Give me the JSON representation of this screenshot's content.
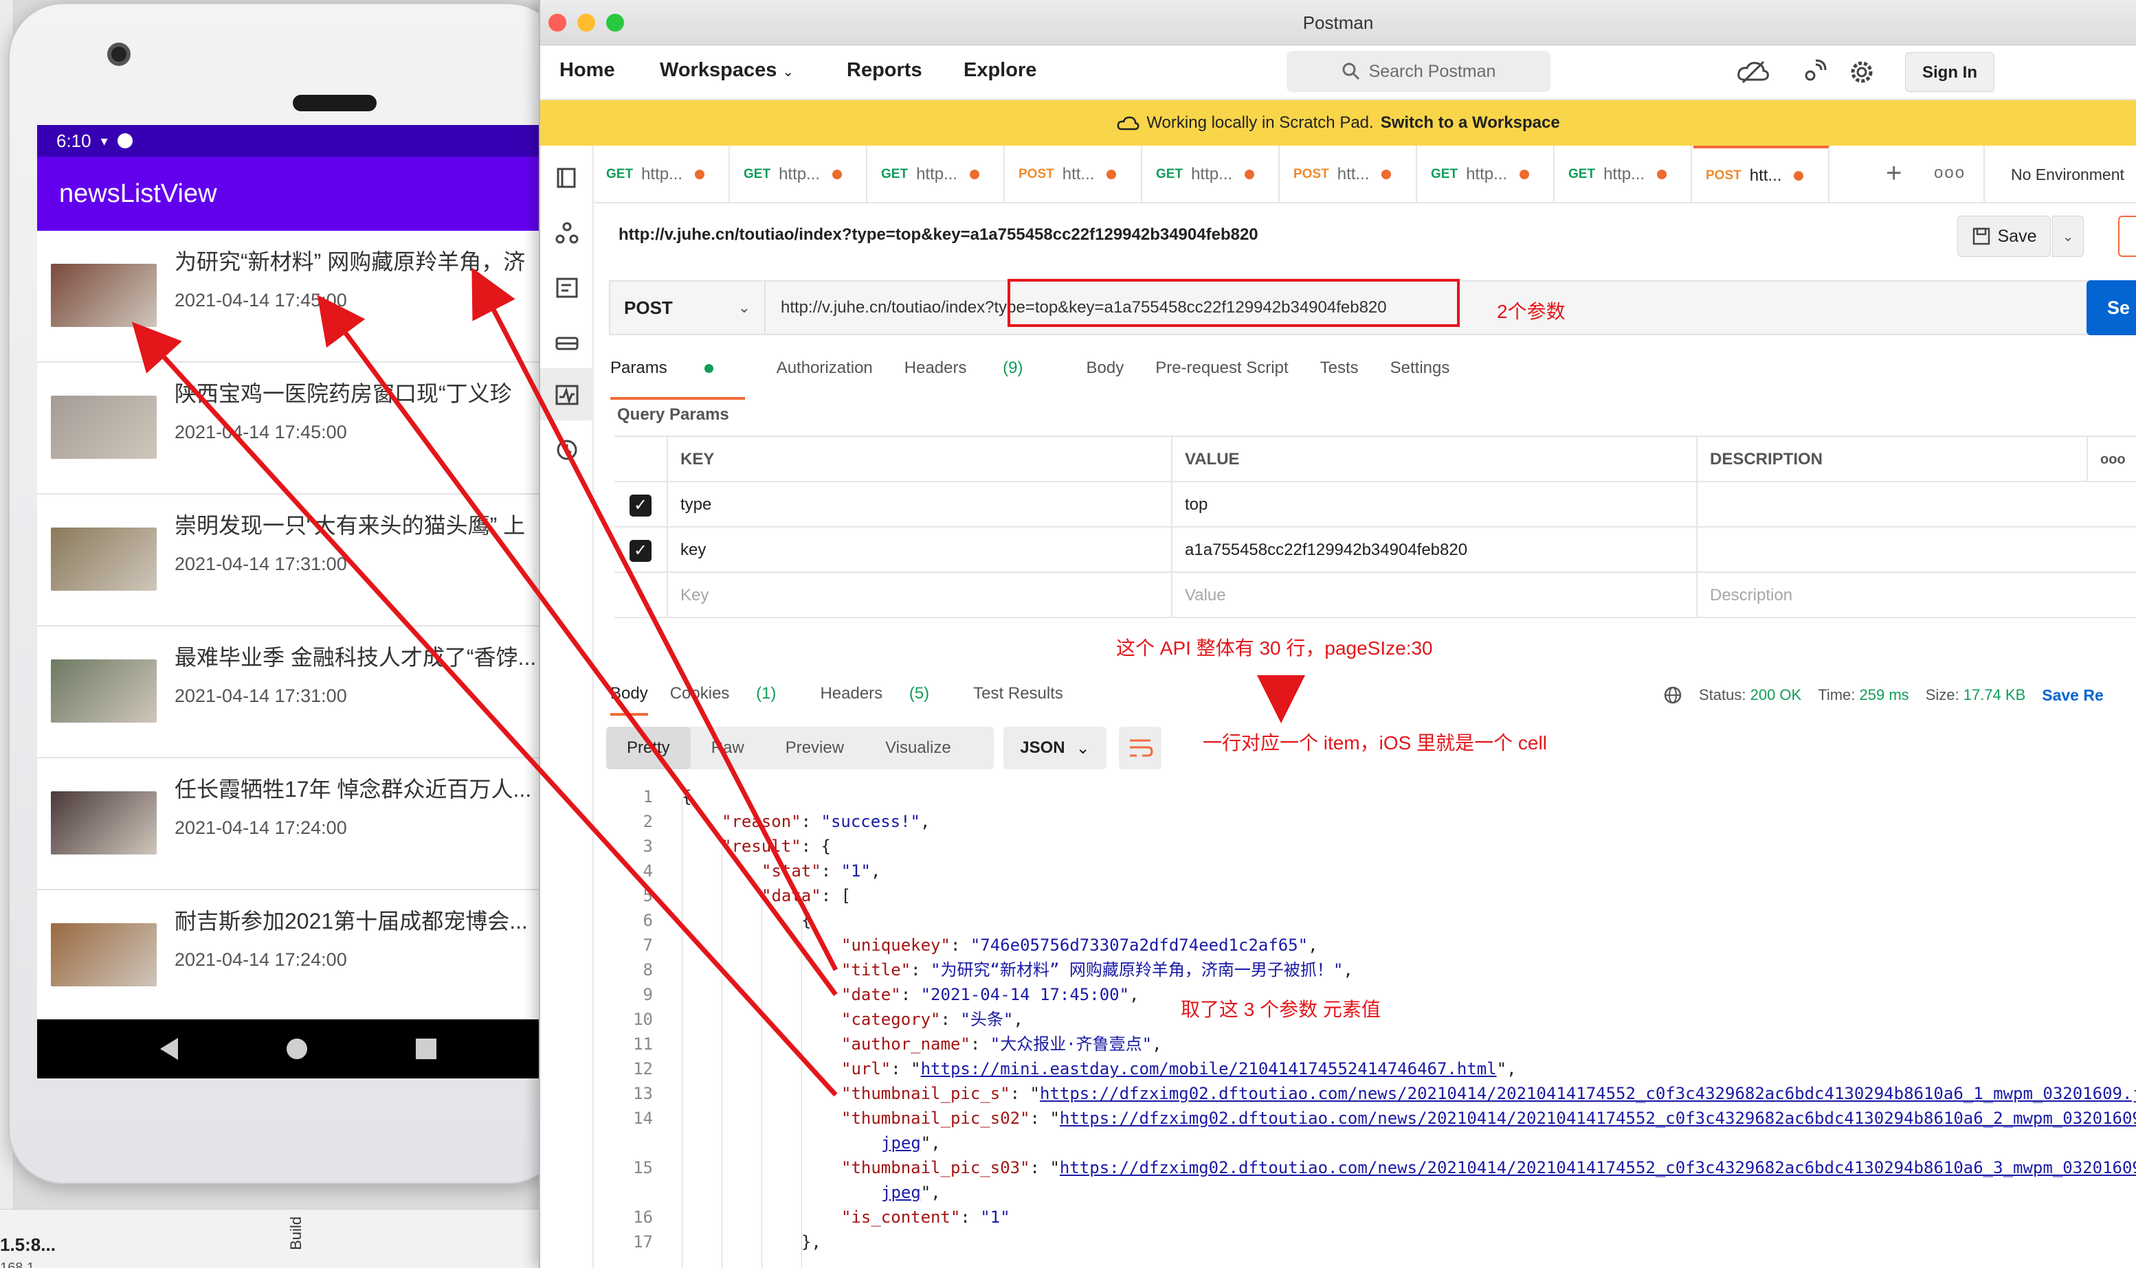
{
  "ide": {
    "version_fragment": "1.5:8...",
    "sub_fragment": "168.1",
    "build_label": "Build"
  },
  "android": {
    "status_time": "6:10",
    "app_title": "newsListView",
    "items": [
      {
        "title": "为研究“新材料” 网购藏原羚羊角，济",
        "date": "2021-04-14 17:45:00",
        "thumb_color": "#7a4a3c"
      },
      {
        "title": "陕西宝鸡一医院药房窗口现“丁义珍",
        "date": "2021-04-14 17:45:00",
        "thumb_color": "#a39c95"
      },
      {
        "title": "崇明发现一只“大有来头的猫头鹰” 上",
        "date": "2021-04-14 17:31:00",
        "thumb_color": "#8a7a5a"
      },
      {
        "title": "最难毕业季 金融科技人才成了“香饽...",
        "date": "2021-04-14 17:31:00",
        "thumb_color": "#6e7a62"
      },
      {
        "title": "任长霞牺牲17年 悼念群众近百万人...",
        "date": "2021-04-14 17:24:00",
        "thumb_color": "#4a3a3a"
      },
      {
        "title": "耐吉斯参加2021第十届成都宠博会...",
        "date": "2021-04-14 17:24:00",
        "thumb_color": "#9a6a40"
      }
    ]
  },
  "postman": {
    "window_title": "Postman",
    "nav": {
      "home": "Home",
      "workspaces": "Workspaces",
      "reports": "Reports",
      "explore": "Explore"
    },
    "search_placeholder": "Search Postman",
    "sign_in": "Sign In",
    "banner_text": "Working locally in Scratch Pad.",
    "banner_link": "Switch to a Workspace",
    "tabs": [
      {
        "method": "GET",
        "label": "http..."
      },
      {
        "method": "GET",
        "label": "http..."
      },
      {
        "method": "GET",
        "label": "http..."
      },
      {
        "method": "POST",
        "label": "htt..."
      },
      {
        "method": "GET",
        "label": "http..."
      },
      {
        "method": "POST",
        "label": "htt..."
      },
      {
        "method": "GET",
        "label": "http..."
      },
      {
        "method": "GET",
        "label": "http..."
      },
      {
        "method": "POST",
        "label": "htt..."
      }
    ],
    "environment": "No Environment",
    "request_name": "http://v.juhe.cn/toutiao/index?type=top&key=a1a755458cc22f129942b34904feb820",
    "save": "Save",
    "method": "POST",
    "url_base": "http://v.juhe.cn/toutiao/index?",
    "url_query": "type=top&key=a1a755458cc22f129942b34904feb820",
    "send": "Se",
    "req_tabs": {
      "params": "Params",
      "authorization": "Authorization",
      "headers": "Headers",
      "headers_count": "(9)",
      "body": "Body",
      "prerequest": "Pre-request Script",
      "tests": "Tests",
      "settings": "Settings"
    },
    "query_params_label": "Query Params",
    "table_headers": {
      "key": "KEY",
      "value": "VALUE",
      "description": "DESCRIPTION",
      "more": "ooo"
    },
    "params": [
      {
        "key": "type",
        "value": "top"
      },
      {
        "key": "key",
        "value": "a1a755458cc22f129942b34904feb820"
      }
    ],
    "placeholders": {
      "key": "Key",
      "value": "Value",
      "description": "Description"
    },
    "resp_tabs": {
      "body": "Body",
      "cookies": "Cookies",
      "cookies_count": "(1)",
      "headers": "Headers",
      "headers_count": "(5)",
      "test_results": "Test Results"
    },
    "status": {
      "status_label": "Status:",
      "status_value": "200 OK",
      "time_label": "Time:",
      "time_value": "259 ms",
      "size_label": "Size:",
      "size_value": "17.74 KB",
      "save_response": "Save Re"
    },
    "view_tabs": {
      "pretty": "Pretty",
      "raw": "Raw",
      "preview": "Preview",
      "visualize": "Visualize"
    },
    "format": "JSON",
    "code_lines": [
      {
        "n": "1",
        "i": 0,
        "parts": [
          [
            "p",
            "{"
          ]
        ]
      },
      {
        "n": "2",
        "i": 1,
        "parts": [
          [
            "k",
            "\"reason\""
          ],
          [
            "p",
            ": "
          ],
          [
            "s",
            "\"success!\""
          ],
          [
            "p",
            ","
          ]
        ]
      },
      {
        "n": "3",
        "i": 1,
        "parts": [
          [
            "k",
            "\"result\""
          ],
          [
            "p",
            ": {"
          ]
        ]
      },
      {
        "n": "4",
        "i": 2,
        "parts": [
          [
            "k",
            "\"stat\""
          ],
          [
            "p",
            ": "
          ],
          [
            "s",
            "\"1\""
          ],
          [
            "p",
            ","
          ]
        ]
      },
      {
        "n": "5",
        "i": 2,
        "parts": [
          [
            "k",
            "\"data\""
          ],
          [
            "p",
            ": ["
          ]
        ]
      },
      {
        "n": "6",
        "i": 3,
        "parts": [
          [
            "p",
            "{"
          ]
        ]
      },
      {
        "n": "7",
        "i": 4,
        "parts": [
          [
            "k",
            "\"uniquekey\""
          ],
          [
            "p",
            ": "
          ],
          [
            "s",
            "\"746e05756d73307a2dfd74eed1c2af65\""
          ],
          [
            "p",
            ","
          ]
        ]
      },
      {
        "n": "8",
        "i": 4,
        "parts": [
          [
            "k",
            "\"title\""
          ],
          [
            "p",
            ": "
          ],
          [
            "s",
            "\"为研究“新材料” 网购藏原羚羊角，济南一男子被抓！\""
          ],
          [
            "p",
            ","
          ]
        ]
      },
      {
        "n": "9",
        "i": 4,
        "parts": [
          [
            "k",
            "\"date\""
          ],
          [
            "p",
            ": "
          ],
          [
            "s",
            "\"2021-04-14 17:45:00\""
          ],
          [
            "p",
            ","
          ]
        ]
      },
      {
        "n": "10",
        "i": 4,
        "parts": [
          [
            "k",
            "\"category\""
          ],
          [
            "p",
            ": "
          ],
          [
            "s",
            "\"头条\""
          ],
          [
            "p",
            ","
          ]
        ]
      },
      {
        "n": "11",
        "i": 4,
        "parts": [
          [
            "k",
            "\"author_name\""
          ],
          [
            "p",
            ": "
          ],
          [
            "s",
            "\"大众报业·齐鲁壹点\""
          ],
          [
            "p",
            ","
          ]
        ]
      },
      {
        "n": "12",
        "i": 4,
        "parts": [
          [
            "k",
            "\"url\""
          ],
          [
            "p",
            ": \""
          ],
          [
            "u",
            "https://mini.eastday.com/mobile/210414174552414746467.html"
          ],
          [
            "p",
            "\","
          ]
        ]
      },
      {
        "n": "13",
        "i": 4,
        "parts": [
          [
            "k",
            "\"thumbnail_pic_s\""
          ],
          [
            "p",
            ": \""
          ],
          [
            "u",
            "https://dfzximg02.dftoutiao.com/news/20210414/20210414174552_c0f3c4329682ac6bdc4130294b8610a6_1_mwpm_03201609.jpeg"
          ]
        ]
      },
      {
        "n": "14",
        "i": 4,
        "parts": [
          [
            "k",
            "\"thumbnail_pic_s02\""
          ],
          [
            "p",
            ": \""
          ],
          [
            "u",
            "https://dfzximg02.dftoutiao.com/news/20210414/20210414174552_c0f3c4329682ac6bdc4130294b8610a6_2_mwpm_03201609."
          ]
        ]
      },
      {
        "n": "",
        "i": 5,
        "parts": [
          [
            "u",
            "jpeg"
          ],
          [
            "p",
            "\","
          ]
        ]
      },
      {
        "n": "15",
        "i": 4,
        "parts": [
          [
            "k",
            "\"thumbnail_pic_s03\""
          ],
          [
            "p",
            ": \""
          ],
          [
            "u",
            "https://dfzximg02.dftoutiao.com/news/20210414/20210414174552_c0f3c4329682ac6bdc4130294b8610a6_3_mwpm_03201609."
          ]
        ]
      },
      {
        "n": "",
        "i": 5,
        "parts": [
          [
            "u",
            "jpeg"
          ],
          [
            "p",
            "\","
          ]
        ]
      },
      {
        "n": "16",
        "i": 4,
        "parts": [
          [
            "k",
            "\"is_content\""
          ],
          [
            "p",
            ": "
          ],
          [
            "s",
            "\"1\""
          ]
        ]
      },
      {
        "n": "17",
        "i": 3,
        "parts": [
          [
            "p",
            "},"
          ]
        ]
      }
    ]
  },
  "annotations": {
    "two_params": "2个参数",
    "page_size": "这个 API 整体有 30 行，pageSIze:30",
    "one_row_one_cell": "一行对应一个 item，iOS 里就是一个 cell",
    "took_three": "取了这 3 个参数 元素值"
  },
  "colors": {
    "accent": "#f26b3a",
    "annotation_red": "#e3161a",
    "android_primary": "#6200ee",
    "android_dark": "#3700b3",
    "send_blue": "#0265d2",
    "banner_yellow": "#f9d54a"
  }
}
